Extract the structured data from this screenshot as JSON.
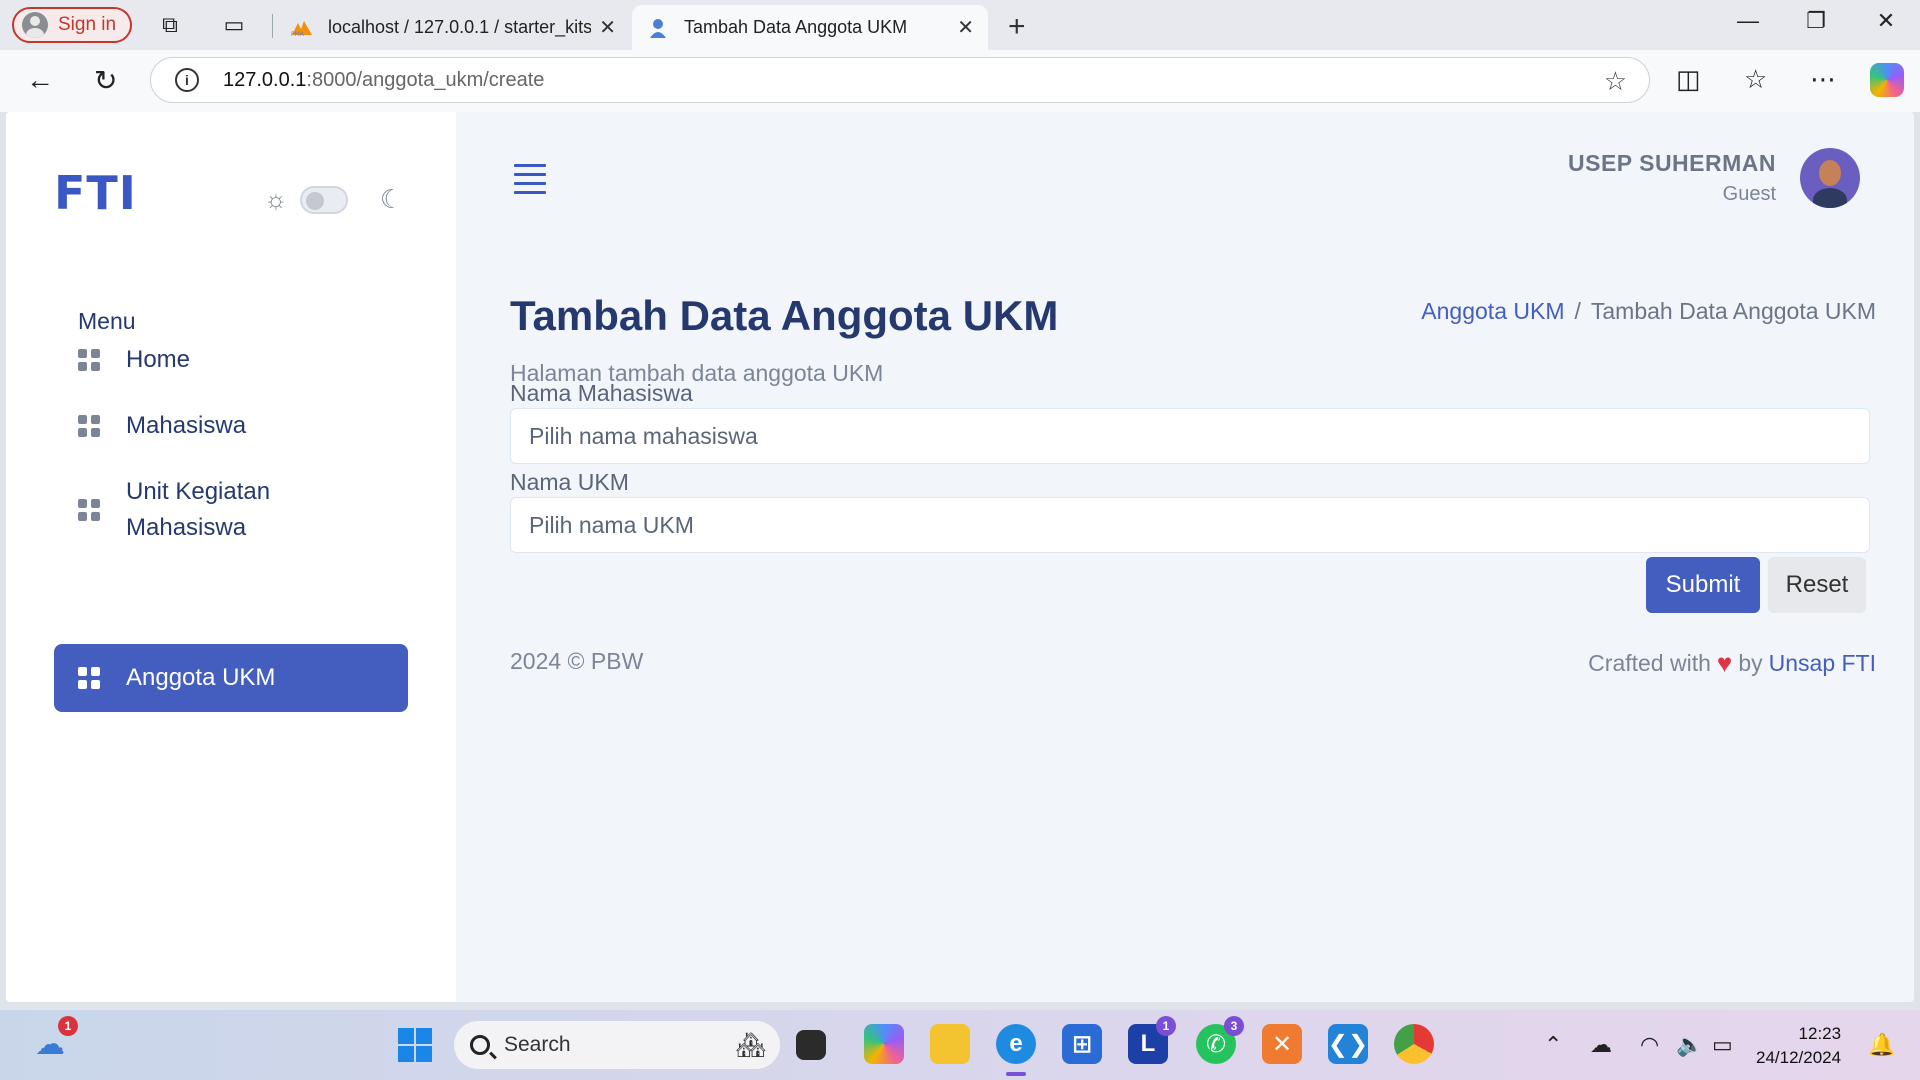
{
  "browser": {
    "signin_label": "Sign in",
    "tabs": [
      {
        "title": "localhost / 127.0.0.1 / starter_kits",
        "icon": "phpmyadmin-icon"
      },
      {
        "title": "Tambah Data Anggota UKM",
        "icon": "page-icon"
      }
    ],
    "url_host": "127.0.0.1",
    "url_path": ":8000/anggota_ukm/create"
  },
  "app": {
    "logo": "FTI",
    "menu_title": "Menu",
    "menu_items": [
      {
        "label": "Home"
      },
      {
        "label": "Mahasiswa"
      },
      {
        "label": "Unit Kegiatan Mahasiswa"
      },
      {
        "label": "Anggota UKM",
        "active": true
      }
    ],
    "user": {
      "name": "USEP SUHERMAN",
      "role": "Guest"
    },
    "page": {
      "title": "Tambah Data Anggota UKM",
      "subtitle": "Halaman tambah data anggota UKM",
      "breadcrumb": [
        "Anggota UKM",
        "Tambah Data Anggota UKM"
      ]
    },
    "form": {
      "mahasiswa_label": "Nama Mahasiswa",
      "mahasiswa_placeholder": "Pilih nama mahasiswa",
      "ukm_label": "Nama UKM",
      "ukm_placeholder": "Pilih nama UKM",
      "submit_label": "Submit",
      "reset_label": "Reset"
    },
    "footer": {
      "left": "2024 © PBW",
      "crafted": "Crafted with",
      "by": "by",
      "link": "Unsap FTI"
    },
    "colors": {
      "primary": "#435ebe",
      "text_dark": "#25396f"
    }
  },
  "taskbar": {
    "search_label": "Search",
    "weather_badge": "1",
    "teams_badge": "1",
    "whatsapp_badge": "3",
    "time": "12:23",
    "date": "24/12/2024"
  }
}
